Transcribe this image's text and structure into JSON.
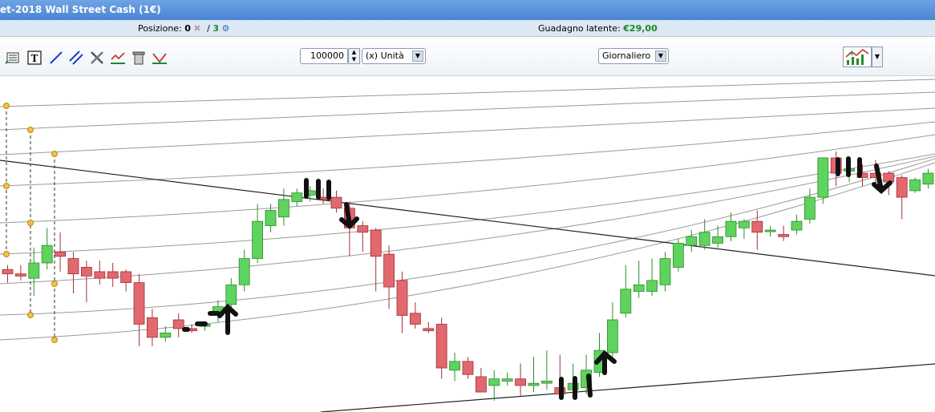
{
  "window": {
    "title": "et-2018  Wall Street Cash (1€)"
  },
  "status": {
    "position_label": "Posizione:",
    "position_open": "0",
    "position_sep": "/",
    "position_total": "3",
    "gain_label": "Guadagno latente:",
    "gain_value": "€29,00"
  },
  "toolbar": {
    "tools": [
      "indicator-list-icon",
      "text-icon",
      "trendline-icon",
      "parallel-lines-icon",
      "tools-icon",
      "trend-signal-icon",
      "trash-icon",
      "delete-signal-icon"
    ],
    "quantity": "100000",
    "unit_select": "(x) Unità",
    "period_select": "Giornaliero",
    "chart_type_icon": "chart-type-icon"
  },
  "colors": {
    "bull": "#5ed35e",
    "bear": "#e0686e",
    "bull_border": "#2e8b2e",
    "bear_border": "#a53035",
    "accent": "#1a8a2a"
  },
  "annotations": [
    "III",
    "III",
    "III",
    "III"
  ],
  "chart_data": {
    "type": "candlestick",
    "title": "",
    "candles": [
      {
        "o": 60,
        "h": 62,
        "l": 54,
        "c": 58
      },
      {
        "o": 58,
        "h": 62,
        "l": 55,
        "c": 57
      },
      {
        "o": 56,
        "h": 70,
        "l": 48,
        "c": 63
      },
      {
        "o": 63,
        "h": 79,
        "l": 60,
        "c": 71
      },
      {
        "o": 68,
        "h": 77,
        "l": 59,
        "c": 66
      },
      {
        "o": 65,
        "h": 68,
        "l": 49,
        "c": 58
      },
      {
        "o": 61,
        "h": 64,
        "l": 45,
        "c": 57
      },
      {
        "o": 59,
        "h": 64,
        "l": 53,
        "c": 56
      },
      {
        "o": 59,
        "h": 63,
        "l": 52,
        "c": 56
      },
      {
        "o": 59,
        "h": 60,
        "l": 50,
        "c": 54
      },
      {
        "o": 54,
        "h": 58,
        "l": 25,
        "c": 35
      },
      {
        "o": 38,
        "h": 42,
        "l": 25,
        "c": 29
      },
      {
        "o": 29,
        "h": 34,
        "l": 27,
        "c": 31
      },
      {
        "o": 37,
        "h": 40,
        "l": 29,
        "c": 33
      },
      {
        "o": 33,
        "h": 35,
        "l": 31,
        "c": 32
      },
      {
        "o": 34,
        "h": 36,
        "l": 32,
        "c": 35
      },
      {
        "o": 39,
        "h": 46,
        "l": 36,
        "c": 43
      },
      {
        "o": 44,
        "h": 56,
        "l": 42,
        "c": 53
      },
      {
        "o": 53,
        "h": 69,
        "l": 50,
        "c": 65
      },
      {
        "o": 65,
        "h": 90,
        "l": 63,
        "c": 82
      },
      {
        "o": 80,
        "h": 90,
        "l": 77,
        "c": 87
      },
      {
        "o": 84,
        "h": 97,
        "l": 80,
        "c": 92
      },
      {
        "o": 91,
        "h": 97,
        "l": 89,
        "c": 95
      },
      {
        "o": 94,
        "h": 98,
        "l": 91,
        "c": 96
      },
      {
        "o": 93,
        "h": 97,
        "l": 90,
        "c": 92
      },
      {
        "o": 93,
        "h": 96,
        "l": 86,
        "c": 88
      },
      {
        "o": 88,
        "h": 91,
        "l": 66,
        "c": 79
      },
      {
        "o": 80,
        "h": 82,
        "l": 68,
        "c": 77
      },
      {
        "o": 78,
        "h": 79,
        "l": 50,
        "c": 66
      },
      {
        "o": 67,
        "h": 71,
        "l": 42,
        "c": 52
      },
      {
        "o": 55,
        "h": 59,
        "l": 31,
        "c": 39
      },
      {
        "o": 40,
        "h": 45,
        "l": 33,
        "c": 35
      },
      {
        "o": 33,
        "h": 36,
        "l": 31,
        "c": 32
      },
      {
        "o": 35,
        "h": 38,
        "l": 10,
        "c": 15
      },
      {
        "o": 14,
        "h": 22,
        "l": 9,
        "c": 18
      },
      {
        "o": 18,
        "h": 20,
        "l": 10,
        "c": 12
      },
      {
        "o": 11,
        "h": 15,
        "l": 5,
        "c": 4
      },
      {
        "o": 7,
        "h": 14,
        "l": 0,
        "c": 10
      },
      {
        "o": 9,
        "h": 13,
        "l": 7,
        "c": 10
      },
      {
        "o": 10,
        "h": 17,
        "l": 2,
        "c": 7
      },
      {
        "o": 7,
        "h": 20,
        "l": 4,
        "c": 8
      },
      {
        "o": 8,
        "h": 23,
        "l": 5,
        "c": 9
      },
      {
        "o": 6,
        "h": 21,
        "l": 4,
        "c": 3
      },
      {
        "o": 5,
        "h": 17,
        "l": 2,
        "c": 8
      },
      {
        "o": 6,
        "h": 21,
        "l": 3,
        "c": 14
      },
      {
        "o": 13,
        "h": 31,
        "l": 11,
        "c": 23
      },
      {
        "o": 22,
        "h": 45,
        "l": 20,
        "c": 37
      },
      {
        "o": 40,
        "h": 62,
        "l": 38,
        "c": 51
      },
      {
        "o": 50,
        "h": 64,
        "l": 47,
        "c": 53
      },
      {
        "o": 50,
        "h": 65,
        "l": 48,
        "c": 55
      },
      {
        "o": 53,
        "h": 68,
        "l": 50,
        "c": 65
      },
      {
        "o": 61,
        "h": 74,
        "l": 59,
        "c": 72
      },
      {
        "o": 71,
        "h": 78,
        "l": 68,
        "c": 75
      },
      {
        "o": 71,
        "h": 83,
        "l": 69,
        "c": 77
      },
      {
        "o": 72,
        "h": 80,
        "l": 70,
        "c": 75
      },
      {
        "o": 75,
        "h": 86,
        "l": 73,
        "c": 82
      },
      {
        "o": 79,
        "h": 83,
        "l": 74,
        "c": 82
      },
      {
        "o": 82,
        "h": 87,
        "l": 69,
        "c": 77
      },
      {
        "o": 78,
        "h": 80,
        "l": 75,
        "c": 78
      },
      {
        "o": 76,
        "h": 80,
        "l": 73,
        "c": 75
      },
      {
        "o": 78,
        "h": 85,
        "l": 76,
        "c": 82
      },
      {
        "o": 83,
        "h": 97,
        "l": 81,
        "c": 93
      },
      {
        "o": 93,
        "h": 111,
        "l": 90,
        "c": 111
      },
      {
        "o": 111,
        "h": 114,
        "l": 98,
        "c": 104
      },
      {
        "o": 105,
        "h": 106,
        "l": 100,
        "c": 106
      },
      {
        "o": 104,
        "h": 108,
        "l": 98,
        "c": 102
      },
      {
        "o": 104,
        "h": 110,
        "l": 97,
        "c": 102
      },
      {
        "o": 104,
        "h": 105,
        "l": 94,
        "c": 100
      },
      {
        "o": 102,
        "h": 103,
        "l": 83,
        "c": 93
      },
      {
        "o": 96,
        "h": 102,
        "l": 95,
        "c": 101
      },
      {
        "o": 99,
        "h": 106,
        "l": 97,
        "c": 104
      },
      {
        "o": 103,
        "h": 108,
        "l": 101,
        "c": 106
      },
      {
        "o": 105,
        "h": 117,
        "l": 103,
        "c": 114
      }
    ]
  }
}
